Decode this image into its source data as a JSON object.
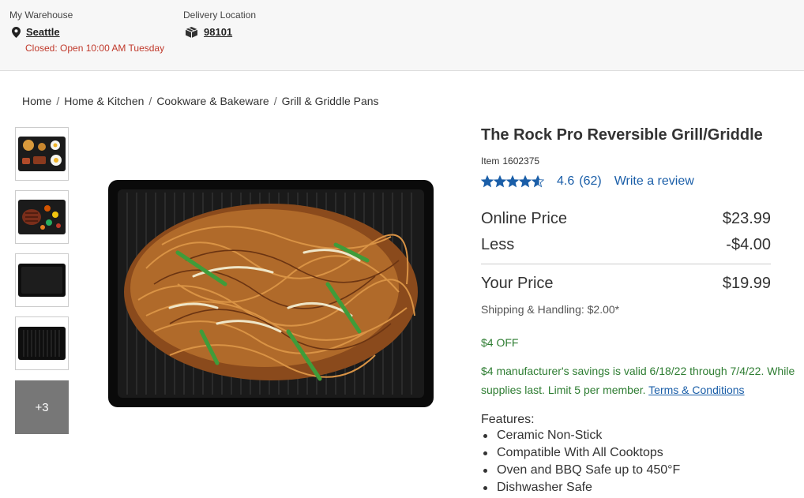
{
  "header": {
    "warehouse_label": "My Warehouse",
    "warehouse_name": "Seattle",
    "warehouse_status": "Closed: Open 10:00 AM Tuesday",
    "delivery_label": "Delivery Location",
    "delivery_zip": "98101",
    "status_color": "#c0392b"
  },
  "breadcrumb": [
    "Home",
    "Home & Kitchen",
    "Cookware & Bakeware",
    "Grill & Griddle Pans"
  ],
  "gallery": {
    "thumbnails": [
      "thumb-breakfast-griddle",
      "thumb-steak-grill",
      "thumb-pan-flat",
      "thumb-pan-ribbed"
    ],
    "more_label": "+3",
    "main_image": "noodles-on-griddle"
  },
  "product": {
    "title": "The Rock Pro Reversible Grill/Griddle",
    "item_label": "Item",
    "item_number": "1602375",
    "rating_value": 4.6,
    "rating_text": "4.6",
    "review_count": "(62)",
    "write_review": "Write a review"
  },
  "pricing": {
    "online_label": "Online Price",
    "online_value": "$23.99",
    "less_label": "Less",
    "less_value": "-$4.00",
    "your_label": "Your Price",
    "your_value": "$19.99",
    "shipping": "Shipping & Handling: $2.00*"
  },
  "promo": {
    "off_label": "$4 OFF",
    "text": "$4 manufacturer's savings is valid 6/18/22 through 7/4/22. While supplies last. Limit 5 per member.",
    "terms_link": "Terms & Conditions",
    "color": "#2e7d32"
  },
  "features": {
    "title": "Features:",
    "items": [
      "Ceramic Non-Stick",
      "Compatible With All Cooktops",
      "Oven and BBQ Safe up to 450°F",
      "Dishwasher Safe"
    ]
  },
  "colors": {
    "link": "#1a5ea8",
    "accent": "#1a5ea8"
  }
}
